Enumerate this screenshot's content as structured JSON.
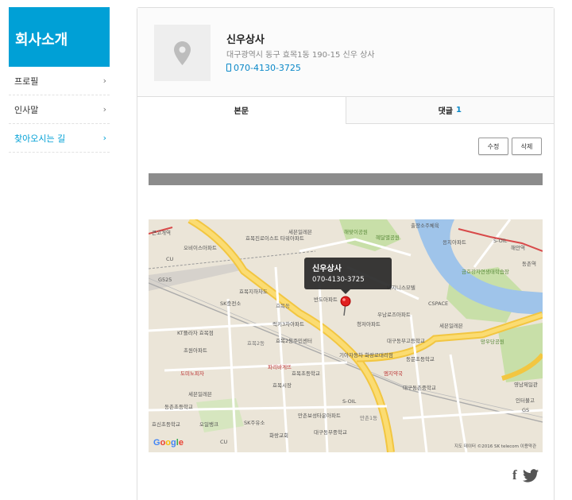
{
  "sidebar": {
    "title": "회사소개",
    "items": [
      {
        "label": "프로필",
        "chevron": "›"
      },
      {
        "label": "인사말",
        "chevron": "›"
      },
      {
        "label": "찾아오시는 길",
        "chevron": "›"
      }
    ]
  },
  "business": {
    "name": "신우상사",
    "address": "대구광역시 동구 효목1동 190-15 신우 상사",
    "phone": "070-4130-3725",
    "icons": {
      "thumbnail": "map-pin-icon",
      "phone": "phone-icon"
    }
  },
  "tabs": [
    {
      "label": "본문"
    },
    {
      "label": "댓글",
      "count": "1"
    }
  ],
  "actions": {
    "edit": "수정",
    "delete": "삭제"
  },
  "map": {
    "bubble_title": "신우상사",
    "bubble_phone": "070-4130-3725",
    "logo": [
      "G",
      "o",
      "o",
      "g",
      "l",
      "e"
    ],
    "attribution": "지도 데이터 ©2016 SK telecom   이용약관",
    "labels": [
      "큰고개역",
      "오비이스아파트",
      "효목진로이스트 타워아파트",
      "세븐일레븐",
      "해맞이공원",
      "혜달별공원",
      "출장소주체육",
      "CU",
      "G525",
      "효목지하차도",
      "SK충전소",
      "반도아파트",
      "효목동",
      "CSPACE",
      "세븐일레븐",
      "금호강자연생태학습장",
      "KT플라자 효목점",
      "럭키3차아파트",
      "청저아파트",
      "망우당공원",
      "초원아파트",
      "효목2동주민센터",
      "효목2동",
      "기아자동차 화랑로대리점",
      "동문초등학교",
      "대구동부고등학교",
      "도미노피자",
      "파리바게뜨",
      "효목초등학교",
      "엠지약국",
      "영남제일관",
      "세븐일레븐",
      "효목시장",
      "S-OIL",
      "대구동촌중학교",
      "만촌보성타운아파트",
      "효신초등학교",
      "오일뱅크",
      "SK주유소",
      "대구동부중학교",
      "만촌1동",
      "인터불고",
      "화랑교회",
      "우남로즈아파트",
      "비지니스모텔",
      "S-OIL",
      "해안역",
      "동촌역",
      "응지아파트",
      "GS",
      "CU",
      "동촌초등학교"
    ]
  },
  "share": {
    "facebook": "f",
    "twitter": "twitter-icon"
  }
}
